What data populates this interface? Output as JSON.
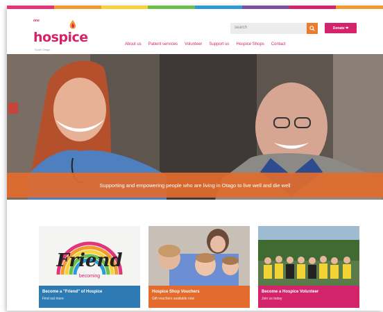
{
  "brand": {
    "logo_small": "one",
    "logo_word": "hospice",
    "logo_tag": "South Otago",
    "colors": {
      "pink": "#d2236b",
      "orange": "#e26b2d",
      "blue": "#2e7ab3",
      "stripe": [
        "#e2357a",
        "#f19a2e",
        "#f8d23c",
        "#6cbf4a",
        "#2e9bd6",
        "#7e4ea0",
        "#d2236b",
        "#f19a2e"
      ]
    }
  },
  "header": {
    "search_placeholder": "search",
    "search_icon": "search-icon",
    "donate_label": "Donate ❤"
  },
  "nav": {
    "items": [
      {
        "label": "About us"
      },
      {
        "label": "Patient services"
      },
      {
        "label": "Volunteer"
      },
      {
        "label": "Support us"
      },
      {
        "label": "Hospice Shops"
      },
      {
        "label": "Contact"
      }
    ]
  },
  "hero": {
    "caption": "Supporting and empowering people who are living in Otago to live well and die well"
  },
  "cards": [
    {
      "title": "Become a \"Friend\" of Hospice",
      "subtitle": "Find out more",
      "badge_word": "Friend",
      "badge_sub": "becoming",
      "color": "#2e7ab3"
    },
    {
      "title": "Hospice Shop Vouchers",
      "subtitle": "Gift vouchers available now",
      "color": "#e26b2d"
    },
    {
      "title": "Become a Hospice Volunteer",
      "subtitle": "Join us today",
      "color": "#d2236b"
    }
  ]
}
